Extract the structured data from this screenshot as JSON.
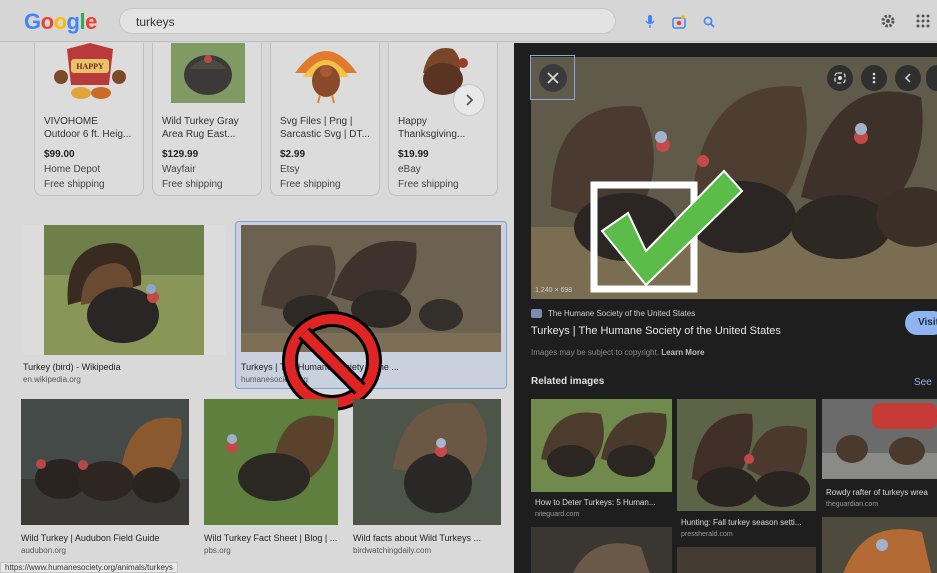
{
  "search": {
    "query": "turkeys"
  },
  "logo": {
    "letters": [
      "G",
      "o",
      "o",
      "g",
      "l",
      "e"
    ],
    "colors": [
      "#4285f4",
      "#ea4335",
      "#fbbc05",
      "#4285f4",
      "#34a853",
      "#ea4335"
    ]
  },
  "icons": {
    "mic": "mic-icon",
    "camera": "camera-icon",
    "search": "search-icon",
    "settings": "gear-icon",
    "apps": "apps-grid-icon"
  },
  "shopping": [
    {
      "title": "VIVOHOME",
      "title2": "Outdoor 6 ft. Heig...",
      "price": "$99.00",
      "store": "Home Depot",
      "shipping": "Free shipping"
    },
    {
      "title": "Wild Turkey Gray",
      "title2": "Area Rug East...",
      "price": "$129.99",
      "store": "Wayfair",
      "shipping": "Free shipping"
    },
    {
      "title": "Svg Files | Png |",
      "title2": "Sarcastic Svg | DT...",
      "price": "$2.99",
      "store": "Etsy",
      "shipping": "Free shipping"
    },
    {
      "title": "Happy",
      "title2": "Thanksgiving...",
      "price": "$19.99",
      "store": "eBay",
      "shipping": "Free shipping"
    }
  ],
  "results": [
    {
      "caption": "Turkey (bird) - Wikipedia",
      "source": "en.wikipedia.org"
    },
    {
      "caption": "Turkeys | The Humane Society of the ...",
      "source": "humanesociety.org"
    },
    {
      "caption": "Wild Turkey | Audubon Field Guide",
      "source": "audubon.org"
    },
    {
      "caption": "Wild Turkey Fact Sheet | Blog | ...",
      "source": "pbs.org"
    },
    {
      "caption": "Wild facts about Wild Turkeys ...",
      "source": "birdwatchingdaily.com"
    }
  ],
  "status_url": "https://www.humanesociety.org/animals/turkeys",
  "panel": {
    "dimensions": "1,240 × 698",
    "site": "The Humane Society of the United States",
    "title": "Turkeys | The Humane Society of the United States",
    "visit": "Visit",
    "copyright": "Images may be subject to copyright.",
    "learn_more": "Learn More",
    "related_header": "Related images",
    "see_all": "See",
    "related": [
      {
        "caption": "How to Deter Turkeys: 5 Human...",
        "source": "niteguard.com"
      },
      {
        "caption": "Hunting: Fall turkey season setti...",
        "source": "pressherald.com"
      },
      {
        "caption": "Rowdy rafter of turkeys wrea",
        "source": "theguardian.com"
      }
    ]
  },
  "overlays": {
    "prohibited": "prohibited-sign-icon",
    "approved": "green-checkmark-icon"
  }
}
